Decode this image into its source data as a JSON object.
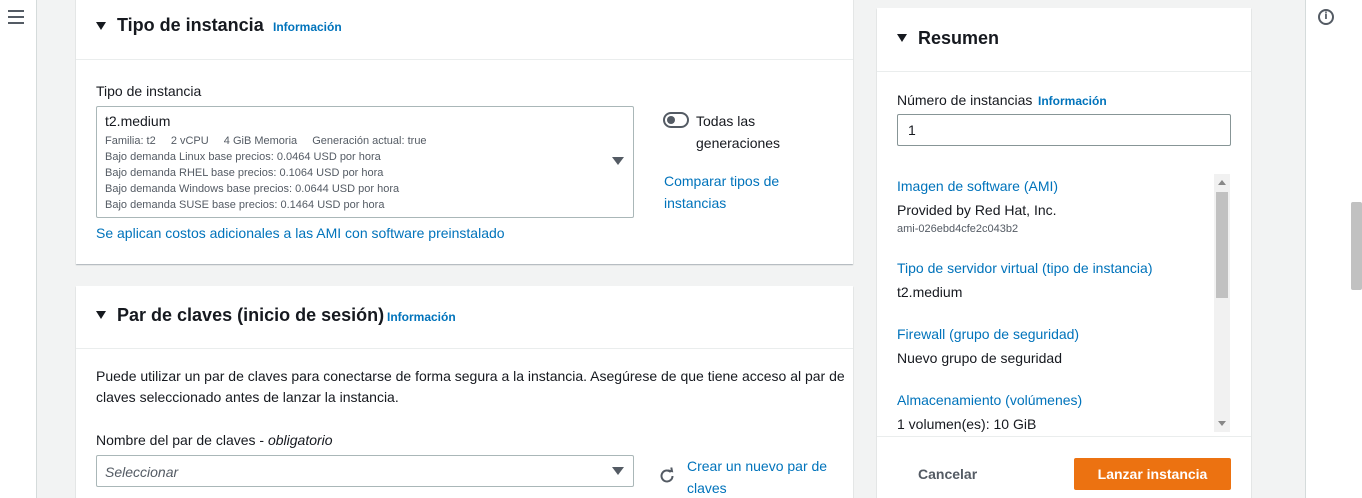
{
  "instance_type_panel": {
    "title": "Tipo de instancia",
    "info": "Información",
    "field_label": "Tipo de instancia",
    "selected": {
      "name": "t2.medium",
      "family": "Familia: t2",
      "vcpu": "2 vCPU",
      "memory": "4 GiB Memoria",
      "generation": "Generación actual: true",
      "linux_price": "Bajo demanda Linux base precios: 0.0464 USD por hora",
      "rhel_price": "Bajo demanda RHEL base precios: 0.1064 USD por hora",
      "windows_price": "Bajo demanda Windows base precios: 0.0644 USD por hora",
      "suse_price": "Bajo demanda SUSE base precios: 0.1464 USD por hora"
    },
    "toggle_label_line1": "Todas las",
    "toggle_label_line2": "generaciones",
    "compare_link_line1": "Comparar tipos de",
    "compare_link_line2": "instancias",
    "ami_cost_link": "Se aplican costos adicionales a las AMI con software preinstalado"
  },
  "key_pair_panel": {
    "title": "Par de claves (inicio de sesión)",
    "info": "Información",
    "description_line1": "Puede utilizar un par de claves para conectarse de forma segura a la instancia. Asegúrese de que tiene acceso al par de",
    "description_line2": "claves seleccionado antes de lanzar la instancia.",
    "field_label": "Nombre del par de claves - ",
    "field_required": "obligatorio",
    "select_placeholder": "Seleccionar",
    "create_link_line1": "Crear un nuevo par de",
    "create_link_line2": "claves"
  },
  "summary_panel": {
    "title": "Resumen",
    "instances_label": "Número de instancias",
    "info": "Información",
    "instances_value": "1",
    "ami_link": "Imagen de software (AMI)",
    "ami_value": "Provided by Red Hat, Inc.",
    "ami_id": "ami-026ebd4cfe2c043b2",
    "server_type_link": "Tipo de servidor virtual (tipo de instancia)",
    "server_type_value": "t2.medium",
    "firewall_link": "Firewall (grupo de seguridad)",
    "firewall_value": "Nuevo grupo de seguridad",
    "storage_link": "Almacenamiento (volúmenes)",
    "storage_value": "1 volumen(es): 10 GiB",
    "cancel_label": "Cancelar",
    "launch_label": "Lanzar instancia"
  },
  "colors": {
    "link": "#0073bb",
    "primary_button": "#ec7211",
    "background": "#f2f3f3"
  },
  "icons": {
    "menu": "hamburger-menu-icon",
    "info": "info-circle-icon",
    "refresh": "refresh-icon"
  }
}
